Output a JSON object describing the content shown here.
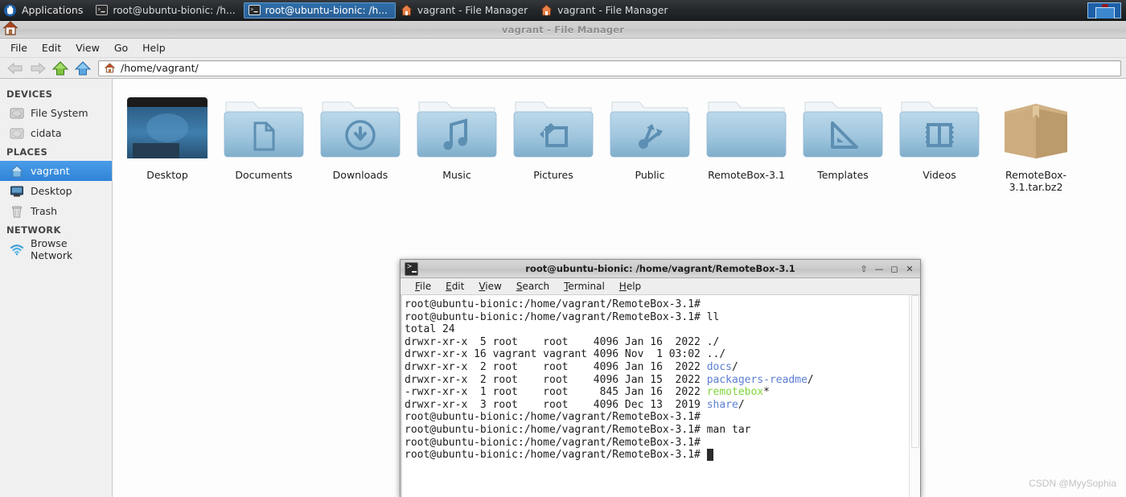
{
  "taskbar": {
    "applications_label": "Applications",
    "applications_icon": "hand-icon",
    "items": [
      {
        "label": "root@ubuntu-bionic: /h...",
        "icon": "terminal-icon",
        "active": false
      },
      {
        "label": "root@ubuntu-bionic: /h...",
        "icon": "terminal-icon",
        "active": true
      },
      {
        "label": "vagrant - File Manager",
        "icon": "home-folder-icon",
        "active": false
      },
      {
        "label": "vagrant - File Manager",
        "icon": "home-folder-icon",
        "active": false
      }
    ],
    "pager_name": "workspace-switcher"
  },
  "file_manager": {
    "window_title": "vagrant - File Manager",
    "app_icon": "home-icon",
    "menus": [
      "File",
      "Edit",
      "View",
      "Go",
      "Help"
    ],
    "toolbar": {
      "back_icon": "arrow-left-icon",
      "forward_icon": "arrow-right-icon",
      "up_icon": "arrow-up-icon",
      "home_icon": "home-icon",
      "path_icon": "home-icon",
      "path_value": "/home/vagrant/"
    },
    "sidebar": {
      "groups": [
        {
          "heading": "DEVICES",
          "items": [
            {
              "label": "File System",
              "icon": "harddisk-icon",
              "selected": false
            },
            {
              "label": "cidata",
              "icon": "harddisk-icon",
              "selected": false
            }
          ]
        },
        {
          "heading": "PLACES",
          "items": [
            {
              "label": "vagrant",
              "icon": "home-icon",
              "selected": true
            },
            {
              "label": "Desktop",
              "icon": "desktop-icon",
              "selected": false
            },
            {
              "label": "Trash",
              "icon": "trash-icon",
              "selected": false
            }
          ]
        },
        {
          "heading": "NETWORK",
          "items": [
            {
              "label": "Browse Network",
              "icon": "network-icon",
              "selected": false
            }
          ]
        }
      ]
    },
    "files": [
      {
        "label": "Desktop",
        "icon": "desktop-folder-icon"
      },
      {
        "label": "Documents",
        "icon": "documents-folder-icon"
      },
      {
        "label": "Downloads",
        "icon": "downloads-folder-icon"
      },
      {
        "label": "Music",
        "icon": "music-folder-icon"
      },
      {
        "label": "Pictures",
        "icon": "pictures-folder-icon"
      },
      {
        "label": "Public",
        "icon": "public-folder-icon"
      },
      {
        "label": "RemoteBox-3.1",
        "icon": "plain-folder-icon"
      },
      {
        "label": "Templates",
        "icon": "templates-folder-icon"
      },
      {
        "label": "Videos",
        "icon": "videos-folder-icon"
      },
      {
        "label": "RemoteBox-3.1.tar.bz2",
        "icon": "archive-box-icon"
      }
    ]
  },
  "terminal": {
    "window_title": "root@ubuntu-bionic: /home/vagrant/RemoteBox-3.1",
    "app_icon": "terminal-icon",
    "window_buttons": {
      "shade_icon": "shade-up-icon",
      "minimize_icon": "minimize-icon",
      "maximize_icon": "maximize-icon",
      "close_icon": "close-icon"
    },
    "menus": [
      {
        "label": "File",
        "mnemonic": "F"
      },
      {
        "label": "Edit",
        "mnemonic": "E"
      },
      {
        "label": "View",
        "mnemonic": "V"
      },
      {
        "label": "Search",
        "mnemonic": "S"
      },
      {
        "label": "Terminal",
        "mnemonic": "T"
      },
      {
        "label": "Help",
        "mnemonic": "H"
      }
    ],
    "prompt": "root@ubuntu-bionic:/home/vagrant/RemoteBox-3.1#",
    "lines": [
      {
        "segments": [
          {
            "text": "root@ubuntu-bionic:/home/vagrant/RemoteBox-3.1#",
            "color": "default"
          }
        ]
      },
      {
        "segments": [
          {
            "text": "root@ubuntu-bionic:/home/vagrant/RemoteBox-3.1# ll",
            "color": "default"
          }
        ]
      },
      {
        "segments": [
          {
            "text": "total 24",
            "color": "default"
          }
        ]
      },
      {
        "segments": [
          {
            "text": "drwxr-xr-x  5 root    root    4096 Jan 16  2022 ./",
            "color": "default"
          }
        ]
      },
      {
        "segments": [
          {
            "text": "drwxr-xr-x 16 vagrant vagrant 4096 Nov  1 03:02 ../",
            "color": "default"
          }
        ]
      },
      {
        "segments": [
          {
            "text": "drwxr-xr-x  2 root    root    4096 Jan 16  2022 ",
            "color": "default"
          },
          {
            "text": "docs",
            "color": "blue"
          },
          {
            "text": "/",
            "color": "default"
          }
        ]
      },
      {
        "segments": [
          {
            "text": "drwxr-xr-x  2 root    root    4096 Jan 15  2022 ",
            "color": "default"
          },
          {
            "text": "packagers-readme",
            "color": "blue"
          },
          {
            "text": "/",
            "color": "default"
          }
        ]
      },
      {
        "segments": [
          {
            "text": "-rwxr-xr-x  1 root    root     845 Jan 16  2022 ",
            "color": "default"
          },
          {
            "text": "remotebox",
            "color": "green"
          },
          {
            "text": "*",
            "color": "default"
          }
        ]
      },
      {
        "segments": [
          {
            "text": "drwxr-xr-x  3 root    root    4096 Dec 13  2019 ",
            "color": "default"
          },
          {
            "text": "share",
            "color": "blue"
          },
          {
            "text": "/",
            "color": "default"
          }
        ]
      },
      {
        "segments": [
          {
            "text": "root@ubuntu-bionic:/home/vagrant/RemoteBox-3.1#",
            "color": "default"
          }
        ]
      },
      {
        "segments": [
          {
            "text": "root@ubuntu-bionic:/home/vagrant/RemoteBox-3.1# man tar",
            "color": "default"
          }
        ]
      },
      {
        "segments": [
          {
            "text": "root@ubuntu-bionic:/home/vagrant/RemoteBox-3.1#",
            "color": "default"
          }
        ]
      },
      {
        "segments": [
          {
            "text": "root@ubuntu-bionic:/home/vagrant/RemoteBox-3.1# ",
            "color": "default"
          },
          {
            "text": " ",
            "color": "cursor"
          }
        ]
      }
    ]
  },
  "watermark": "CSDN @MyySophia",
  "colors": {
    "taskbar_bg": "#24272a",
    "taskbar_active": "#2f6ea8",
    "selection_blue": "#2f83d8",
    "folder_blue": "#9dc6e0",
    "terminal_blue": "#5b7fd4",
    "terminal_green": "#7fd43a",
    "archive_tan": "#caa97a"
  }
}
